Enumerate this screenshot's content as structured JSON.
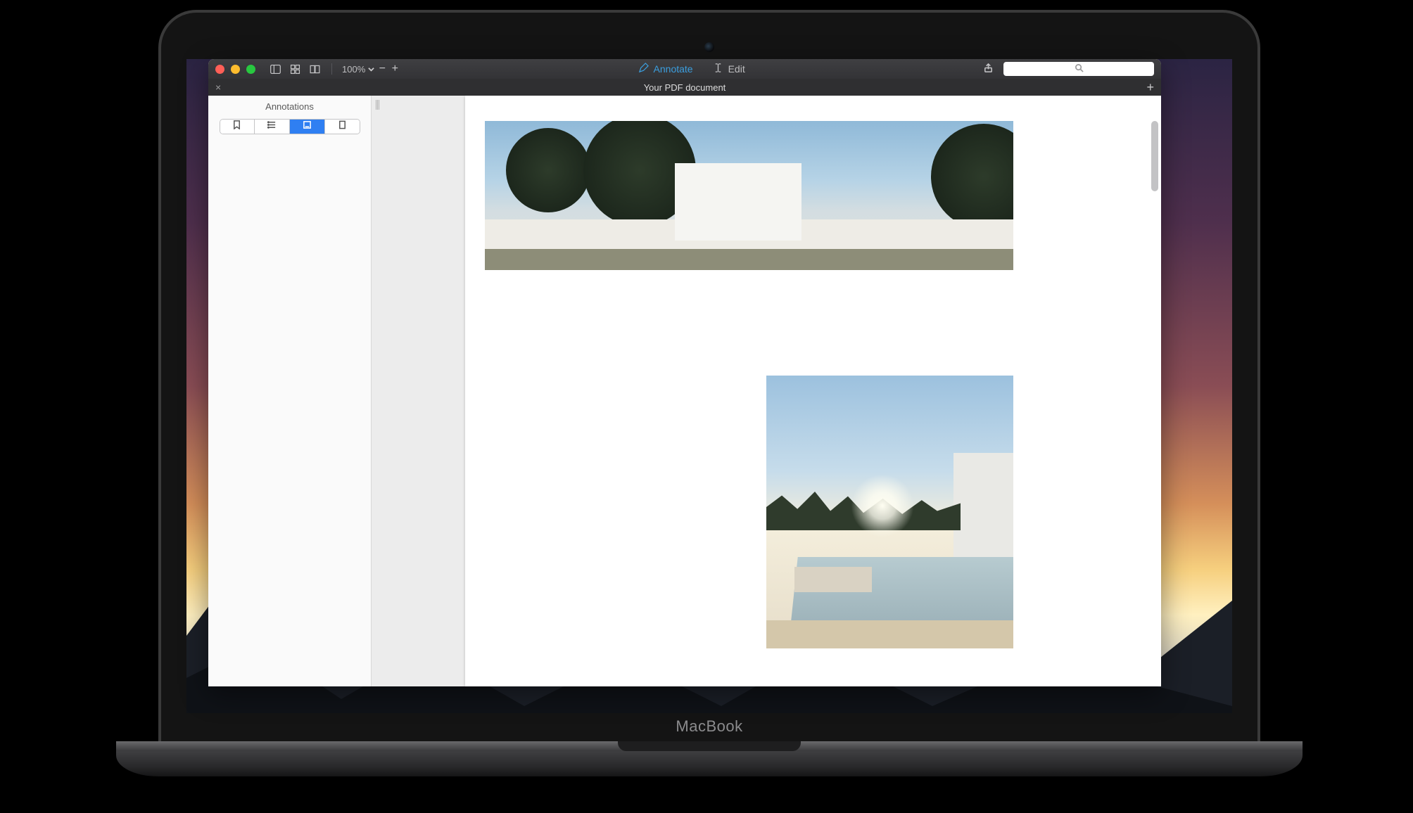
{
  "toolbar": {
    "zoom_level": "100%",
    "annotate_label": "Annotate",
    "edit_label": "Edit",
    "search_placeholder": ""
  },
  "tab": {
    "title": "Your PDF document"
  },
  "sidebar": {
    "title": "Annotations",
    "segments": [
      {
        "name": "bookmarks-segment",
        "active": false
      },
      {
        "name": "outline-segment",
        "active": false
      },
      {
        "name": "annotations-segment",
        "active": true
      },
      {
        "name": "thumbnails-segment",
        "active": false
      }
    ]
  },
  "device": {
    "label": "MacBook"
  },
  "icons": {
    "sidebar_toggle": "sidebar-toggle-icon",
    "grid": "grid-icon",
    "dual": "dual-page-icon",
    "chevron": "chevron-down-icon",
    "minus": "−",
    "plus": "+",
    "pen": "pen-icon",
    "text_cursor": "text-cursor-icon",
    "share": "share-icon",
    "search": "search-icon",
    "bookmark": "bookmark-icon",
    "list": "list-icon",
    "highlight": "highlight-icon",
    "page": "page-icon",
    "close": "×",
    "add": "+"
  }
}
